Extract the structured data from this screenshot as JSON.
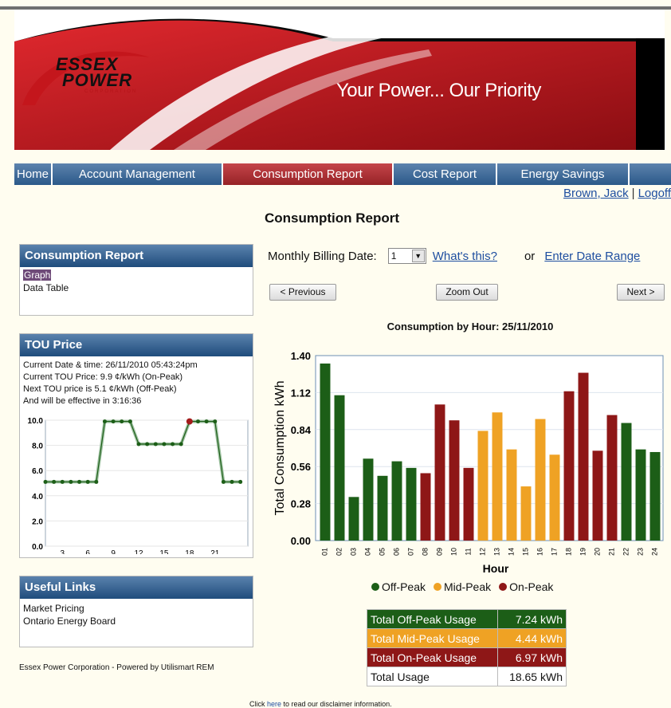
{
  "brand": {
    "logo_line1": "ESSEX",
    "logo_line2": "POWER",
    "logo_line3": "CORPORATION",
    "tagline": "Your Power... Our Priority",
    "colors": {
      "red": "#c4161c",
      "nav_blue": "#2b5989",
      "off_peak": "#1c5e17",
      "mid_peak": "#efa224",
      "on_peak": "#8e1717"
    }
  },
  "nav": {
    "items": [
      {
        "label": "Home",
        "w": 48
      },
      {
        "label": "Account Management",
        "w": 214
      },
      {
        "label": "Consumption Report",
        "w": 214,
        "active": true
      },
      {
        "label": "Cost Report",
        "w": 130
      },
      {
        "label": "Energy Savings",
        "w": 166
      }
    ]
  },
  "user": {
    "name": "Brown, Jack",
    "logoff": "Logoff"
  },
  "page_title": "Consumption Report",
  "sidebar": {
    "consumption": {
      "title": "Consumption Report",
      "items": [
        "Graph",
        "Data Table"
      ]
    },
    "tou": {
      "title": "TOU Price",
      "info": [
        "Current Date & time: 26/11/2010 05:43:24pm",
        "Current TOU Price: 9.9 ¢/kWh (On-Peak)",
        "Next TOU price is 5.1 ¢/kWh (Off-Peak)",
        "And will be effective in 3:16:36"
      ]
    },
    "links": {
      "title": "Useful Links",
      "items": [
        "Market Pricing",
        "Ontario Energy Board"
      ]
    },
    "footer": "Essex Power Corporation - Powered by Utilismart REM"
  },
  "controls": {
    "billing_label": "Monthly Billing Date:",
    "billing_value": "1",
    "whats_this": "What's this?",
    "or": "or",
    "date_range": "Enter Date Range",
    "prev": "< Previous",
    "zoom_out": "Zoom Out",
    "next": "Next >"
  },
  "usage": {
    "rows": [
      {
        "label": "Total Off-Peak Usage",
        "value": "7.24 kWh"
      },
      {
        "label": "Total Mid-Peak Usage",
        "value": "4.44 kWh"
      },
      {
        "label": "Total On-Peak Usage",
        "value": "6.97 kWh"
      },
      {
        "label": "Total Usage",
        "value": "18.65 kWh"
      }
    ]
  },
  "disclaimer": {
    "prefix": "Click ",
    "link": "here",
    "suffix": " to read our disclaimer information."
  },
  "chart_data": [
    {
      "type": "bar",
      "title": "Consumption by Hour: 25/11/2010",
      "xlabel": "Hour",
      "ylabel": "Total Consumption kWh",
      "ylim": [
        0,
        1.4
      ],
      "yticks": [
        "0.00",
        "0.28",
        "0.56",
        "0.84",
        "1.12",
        "1.40"
      ],
      "categories": [
        "01",
        "02",
        "03",
        "04",
        "05",
        "06",
        "07",
        "08",
        "09",
        "10",
        "11",
        "12",
        "13",
        "14",
        "15",
        "16",
        "17",
        "18",
        "19",
        "20",
        "21",
        "22",
        "23",
        "24"
      ],
      "values": [
        1.34,
        1.1,
        0.33,
        0.62,
        0.49,
        0.6,
        0.55,
        0.51,
        1.03,
        0.91,
        0.55,
        0.83,
        0.97,
        0.69,
        0.41,
        0.92,
        0.65,
        1.13,
        1.27,
        0.68,
        0.95,
        0.89,
        0.69,
        0.67
      ],
      "periods": [
        "off",
        "off",
        "off",
        "off",
        "off",
        "off",
        "off",
        "on",
        "on",
        "on",
        "on",
        "mid",
        "mid",
        "mid",
        "mid",
        "mid",
        "mid",
        "on",
        "on",
        "on",
        "on",
        "off",
        "off",
        "off"
      ],
      "legend": [
        "Off-Peak",
        "Mid-Peak",
        "On-Peak"
      ],
      "legend_placement": "bottom",
      "grid": true
    },
    {
      "type": "line",
      "title": "",
      "ylim": [
        0,
        10
      ],
      "yticks": [
        "0.0",
        "2.0",
        "4.0",
        "6.0",
        "8.0",
        "10.0"
      ],
      "xticks": [
        "3",
        "6",
        "9",
        "12",
        "15",
        "18",
        "21"
      ],
      "x": [
        1,
        2,
        3,
        4,
        5,
        6,
        7,
        8,
        9,
        10,
        11,
        12,
        13,
        14,
        15,
        16,
        17,
        18,
        19,
        20,
        21,
        22,
        23,
        24
      ],
      "values": [
        5.1,
        5.1,
        5.1,
        5.1,
        5.1,
        5.1,
        5.1,
        9.9,
        9.9,
        9.9,
        9.9,
        8.1,
        8.1,
        8.1,
        8.1,
        8.1,
        8.1,
        9.9,
        9.9,
        9.9,
        9.9,
        5.1,
        5.1,
        5.1
      ],
      "current_hour": 18
    }
  ]
}
